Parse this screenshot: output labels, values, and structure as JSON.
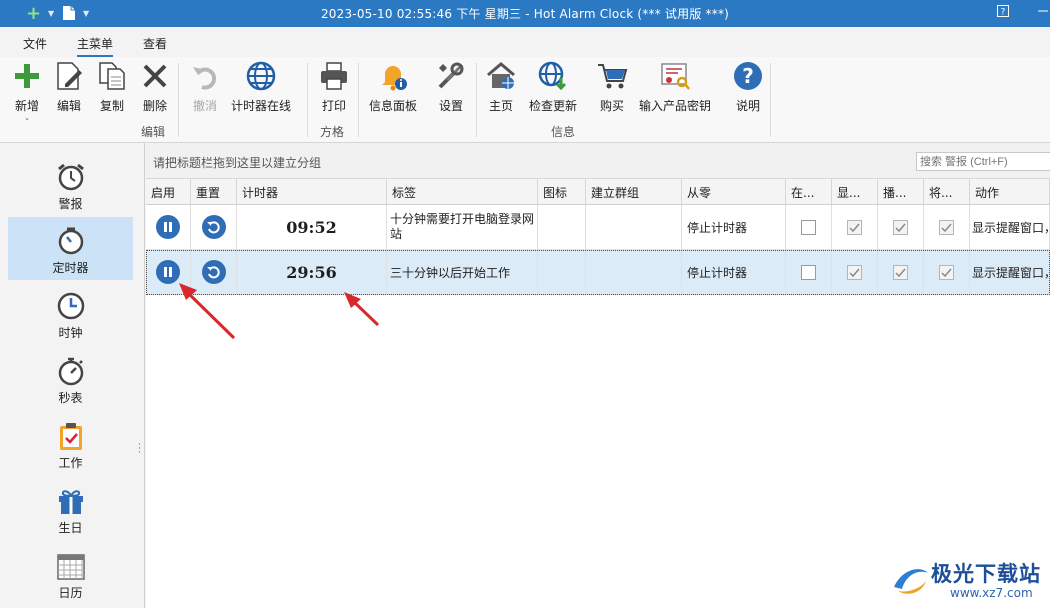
{
  "window": {
    "title": "2023-05-10 02:55:46 下午 星期三 - Hot Alarm Clock (*** 试用版 ***)",
    "help_label": "?"
  },
  "ribbon_tabs": [
    {
      "label": "文件"
    },
    {
      "label": "主菜单",
      "active": true
    },
    {
      "label": "查看"
    }
  ],
  "ribbon": {
    "buttons": {
      "new": "新增",
      "edit": "编辑",
      "copy": "复制",
      "delete": "删除",
      "undo": "撤消",
      "timer_online": "计时器在线",
      "print": "打印",
      "info_panel": "信息面板",
      "settings": "设置",
      "home": "主页",
      "check_update": "检查更新",
      "buy": "购买",
      "enter_key": "输入产品密钥",
      "help": "说明"
    },
    "groups": {
      "edit": "编辑",
      "style": "方格",
      "info": "信息"
    }
  },
  "nav": [
    {
      "label": "警报",
      "icon": "alarm-clock-icon"
    },
    {
      "label": "定时器",
      "icon": "timer-icon",
      "active": true
    },
    {
      "label": "时钟",
      "icon": "clock-icon"
    },
    {
      "label": "秒表",
      "icon": "stopwatch-icon"
    },
    {
      "label": "工作",
      "icon": "clipboard-check-icon"
    },
    {
      "label": "生日",
      "icon": "gift-icon"
    },
    {
      "label": "日历",
      "icon": "calendar-icon"
    }
  ],
  "grid": {
    "group_hint": "请把标题栏拖到这里以建立分组",
    "search_placeholder": "搜索 警报 (Ctrl+F)",
    "columns": [
      "启用",
      "重置",
      "计时器",
      "标签",
      "图标",
      "建立群组",
      "从零",
      "在...",
      "显...",
      "播...",
      "将...",
      "动作"
    ],
    "rows": [
      {
        "timer": "09:52",
        "label": "十分钟需要打开电脑登录网站",
        "from_zero": "停止计时器",
        "checks": [
          false,
          true,
          true,
          true
        ],
        "action": "显示提醒窗口，"
      },
      {
        "timer": "29:56",
        "label": "三十分钟以后开始工作",
        "from_zero": "停止计时器",
        "checks": [
          false,
          true,
          true,
          true
        ],
        "action": "显示提醒窗口，",
        "selected": true
      }
    ]
  },
  "watermark": {
    "name": "极光下载站",
    "url": "www.xz7.com"
  },
  "colors": {
    "titlebar": "#2b79c2",
    "accent": "#2f6db6",
    "selected_row": "#dcebf8",
    "annotation_arrow": "#d8282c"
  }
}
